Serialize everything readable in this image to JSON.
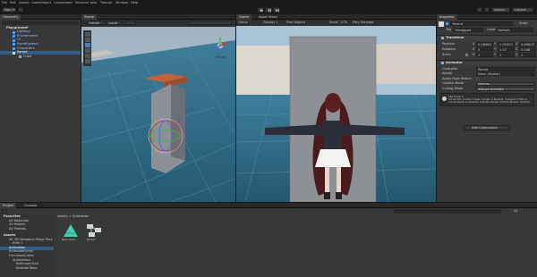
{
  "menubar": {
    "items": [
      "File",
      "Edit",
      "Assets",
      "GameObject",
      "Component",
      "Services",
      "Jobs",
      "Tutorial",
      "Window",
      "Help"
    ]
  },
  "toolbar": {
    "account_label": "Sign in",
    "layers_label": "Layers",
    "layout_label": "Layout"
  },
  "hierarchy": {
    "tab": "Hierarchy",
    "items": [
      {
        "label": "Playground*",
        "depth": 0
      },
      {
        "label": "Lighting",
        "depth": 1
      },
      {
        "label": "Environment",
        "depth": 1
      },
      {
        "label": "UI",
        "depth": 1
      },
      {
        "label": "EventSystem",
        "depth": 1
      },
      {
        "label": "Characters",
        "depth": 1
      },
      {
        "label": "Parent",
        "depth": 1
      },
      {
        "label": "Cube",
        "depth": 2
      }
    ]
  },
  "scene": {
    "tab": "Scene",
    "tools": [
      "Center",
      "Local"
    ],
    "persp_label": "< Persp"
  },
  "game": {
    "tabs": [
      "Game",
      "Asset Store"
    ],
    "mode": "Game",
    "display": "Display 1",
    "aspect": "Free Aspect",
    "scale": "Scale",
    "scale_value": "1.0x",
    "play_focused": "Play Focused"
  },
  "inspector": {
    "tab": "Inspector",
    "object_name": "Parent",
    "static_label": "Static",
    "tag_label": "Tag",
    "tag_value": "Untagged",
    "layer_label": "Layer",
    "layer_value": "Default",
    "transform": {
      "title": "Transform",
      "rows": [
        {
          "label": "Position",
          "x": "0.08480",
          "y": "1.95352",
          "z": "4.69805"
        },
        {
          "label": "Rotation",
          "x": "0",
          "y": "1.07",
          "z": "0.048"
        },
        {
          "label": "Scale",
          "x": "1",
          "y": "1",
          "z": "1"
        }
      ]
    },
    "animator": {
      "title": "Animator",
      "rows": [
        {
          "label": "Controller",
          "value": "Parent"
        },
        {
          "label": "Avatar",
          "value": "None (Avatar)"
        },
        {
          "label": "Apply Root Motion",
          "value": ""
        },
        {
          "label": "Update Mode",
          "value": "Normal"
        },
        {
          "label": "Culling Mode",
          "value": "Always Animate"
        }
      ],
      "info": "Clip Count: 0\nCurves Pos: 0 Quat: 0 Euler: 0 Scale: 0 Muscles: 0 Generic: 0 PPtr: 0\nCurves Count: 0 Constant: 0 (0.0%) Dense: 0 (0.0%) Stream: 0 (0.0%)"
    },
    "add_component": "Add Component"
  },
  "project": {
    "tabs": [
      "Project",
      "Console"
    ],
    "breadcrumb": "Assets > Animation",
    "count": "24",
    "favorites_label": "Favorites",
    "favorites": [
      "All Materials",
      "All Models",
      "All Prefabs"
    ],
    "assets_label": "Assets",
    "tree": [
      "4K 3D Weapons Mega Pack",
      "Rifle 1",
      "Animation",
      "AnimatedSkins",
      "FurnishedCabin",
      "Animations",
      "BathroomSink",
      "BedsideTable"
    ],
    "files": [
      {
        "name": "New Anim...",
        "icon": "animation-clip-icon"
      },
      {
        "name": "Parent",
        "icon": "animator-controller-icon"
      }
    ]
  },
  "colors": {
    "accent": "#4a9eff",
    "panel": "#383838",
    "sky": "#a6c2d8",
    "water": "#2f6f8e"
  }
}
